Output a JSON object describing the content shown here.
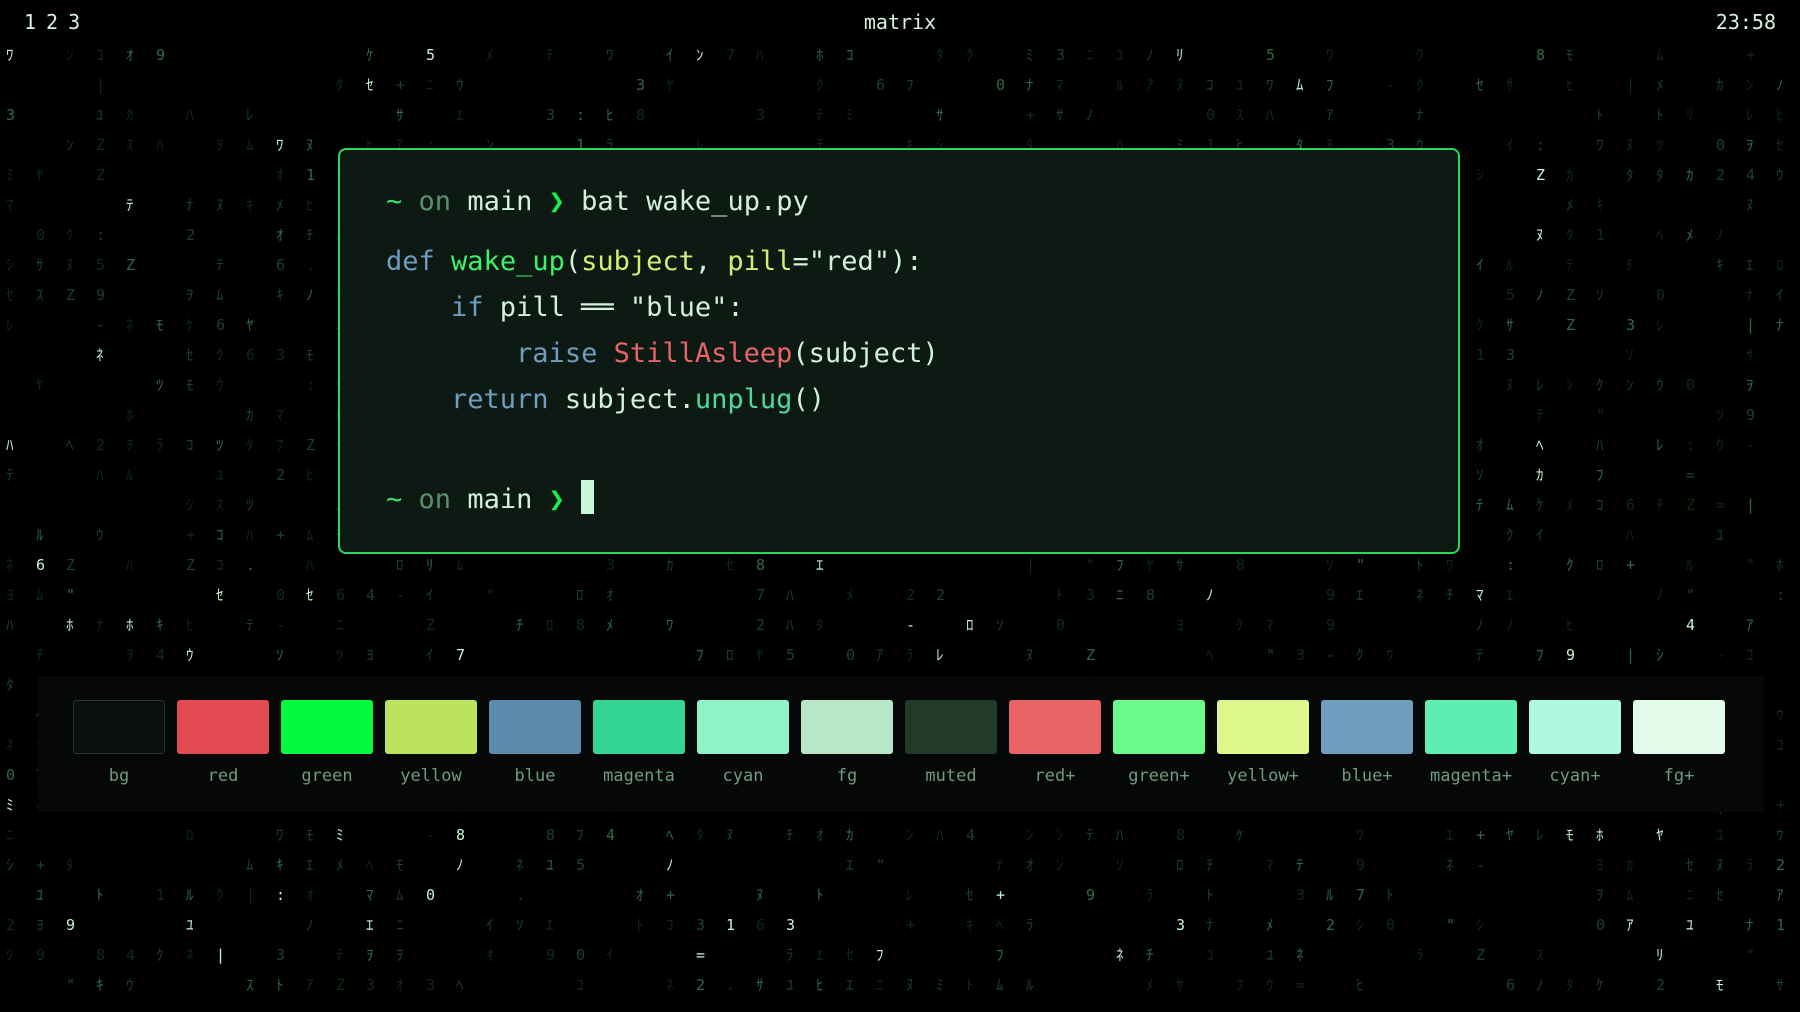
{
  "topbar": {
    "workspaces": [
      "1",
      "2",
      "3"
    ],
    "title": "matrix",
    "clock": "23:58"
  },
  "terminal": {
    "prompt1": {
      "tilde": "~",
      "on": "on",
      "branch": "main",
      "chevron": "❯",
      "command": "bat wake_up.py"
    },
    "code": {
      "l1": {
        "def": "def",
        "fn": "wake_up",
        "open": "(",
        "arg1": "subject",
        "comma": ", ",
        "arg2": "pill",
        "eq": "=",
        "default": "\"red\"",
        "close": "):"
      },
      "l2": {
        "if": "if",
        "expr": " pill ══ ",
        "str": "\"blue\"",
        "colon": ":"
      },
      "l3": {
        "raise": "raise",
        "exc": "StillAsleep",
        "args": "(subject)"
      },
      "l4": {
        "ret": "return",
        "obj": " subject.",
        "meth": "unplug",
        "call": "()"
      }
    },
    "prompt2": {
      "tilde": "~",
      "on": "on",
      "branch": "main",
      "chevron": "❯"
    }
  },
  "palette": [
    {
      "label": "bg",
      "color": "#0a100c",
      "border": "#26342a"
    },
    {
      "label": "red",
      "color": "#e34b52"
    },
    {
      "label": "green",
      "color": "#06fa3d"
    },
    {
      "label": "yellow",
      "color": "#bce35c"
    },
    {
      "label": "blue",
      "color": "#5d8bab"
    },
    {
      "label": "magenta",
      "color": "#34d494"
    },
    {
      "label": "cyan",
      "color": "#8ff2c8"
    },
    {
      "label": "fg",
      "color": "#b6e8c8"
    },
    {
      "label": "muted",
      "color": "#213a2a"
    },
    {
      "label": "red+",
      "color": "#e86363"
    },
    {
      "label": "green+",
      "color": "#6dfa8c"
    },
    {
      "label": "yellow+",
      "color": "#def78d"
    },
    {
      "label": "blue+",
      "color": "#729ebe"
    },
    {
      "label": "magenta+",
      "color": "#5eedb2"
    },
    {
      "label": "cyan+",
      "color": "#aff8e0"
    },
    {
      "label": "fg+",
      "color": "#e2faea"
    }
  ]
}
